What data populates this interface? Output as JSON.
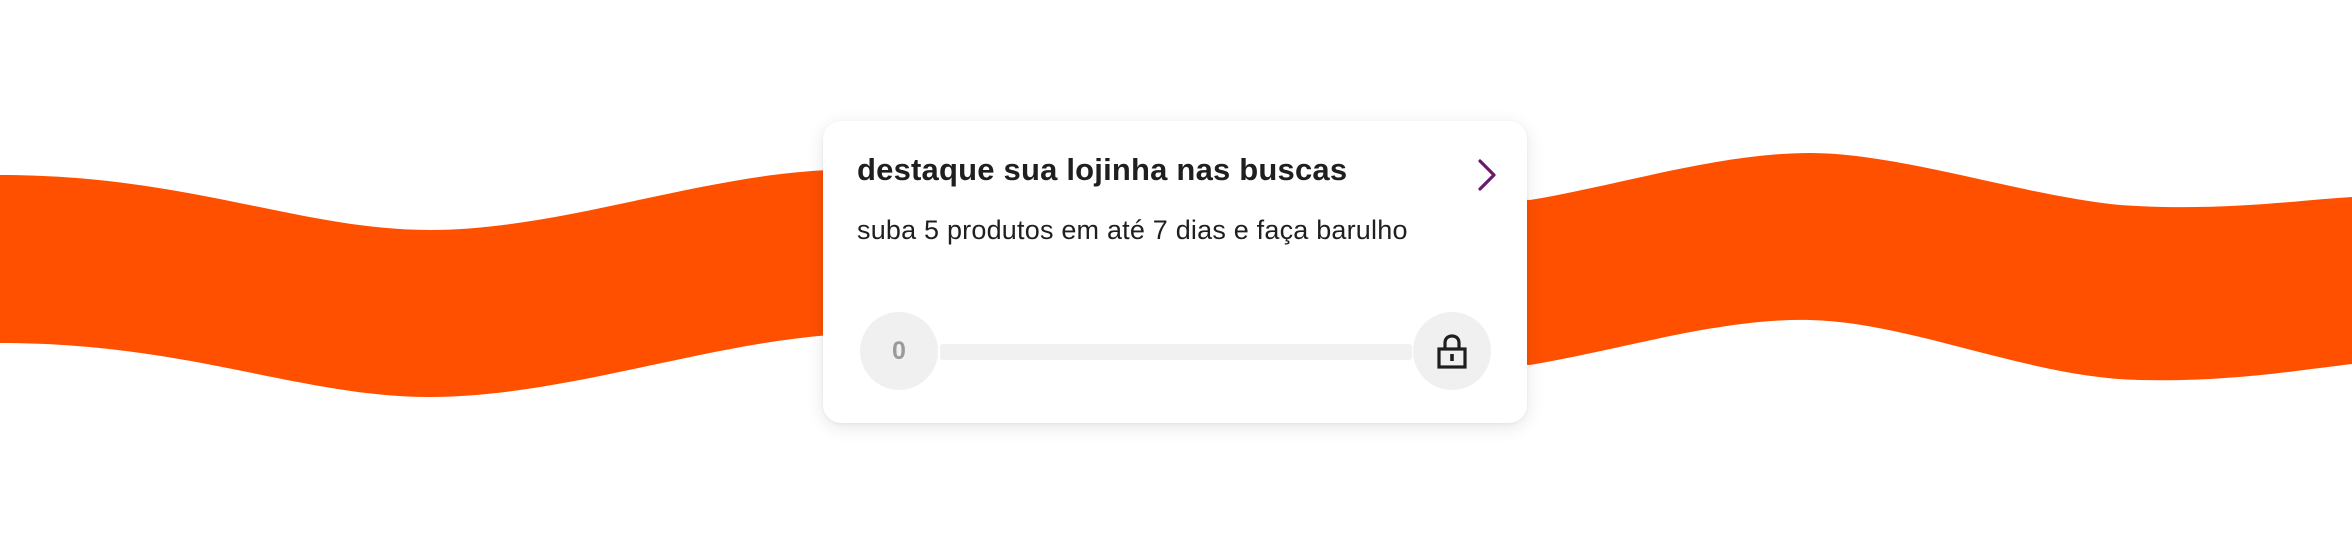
{
  "colors": {
    "wave": "#ff5000",
    "background": "#ffffff",
    "card": "#ffffff",
    "title_text": "#1f1f1f",
    "chevron": "#6a1a6e",
    "track": "#f1f1f1",
    "step_circle": "#f0f0f0",
    "step_label": "#9a9a9a",
    "lock": "#1f1f1f"
  },
  "card": {
    "title": "destaque sua lojinha nas buscas",
    "subtitle": "suba 5 produtos em até 7 dias e faça barulho",
    "action_icon": "chevron-right-icon"
  },
  "progress": {
    "start_label": "0",
    "value": 0,
    "end_icon": "lock-icon"
  }
}
